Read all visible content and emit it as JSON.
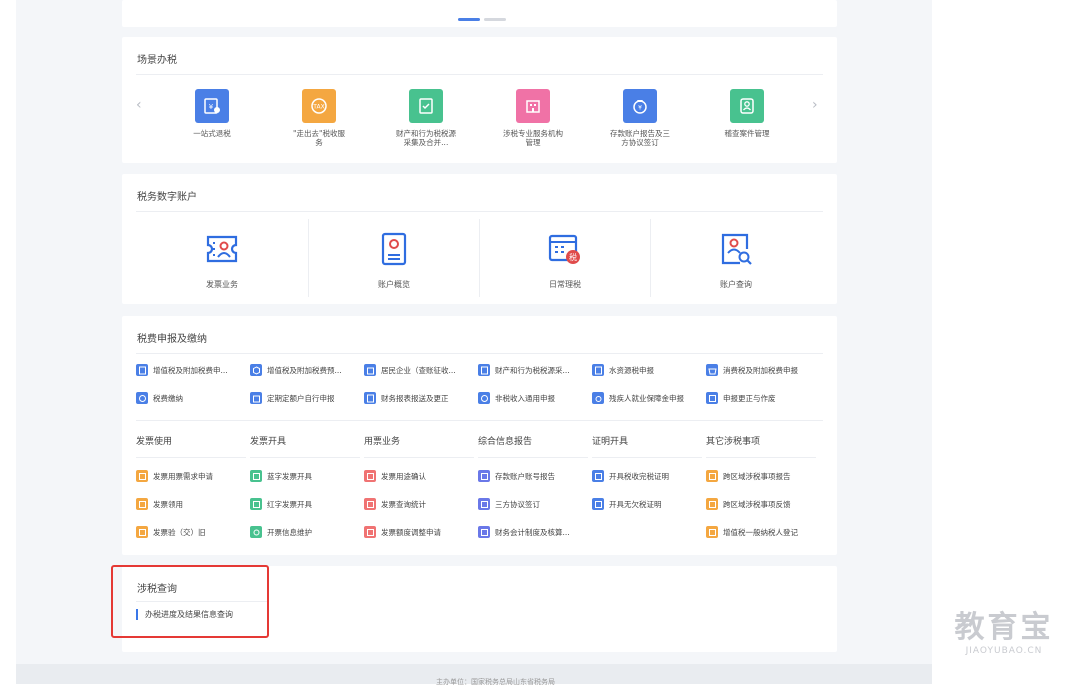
{
  "colors": {
    "blue": "#4a7fe6",
    "orange": "#f4a741",
    "green": "#48c28f",
    "pink": "#f072a6",
    "purple": "#6a78e8",
    "red": "#e53935"
  },
  "scene": {
    "title": "场景办税",
    "items": [
      {
        "label": "一站式退税",
        "icon": "refund-icon",
        "color": "#4a7fe6"
      },
      {
        "label": "\"走出去\"税收服务",
        "icon": "tax-globe-icon",
        "color": "#f4a741"
      },
      {
        "label": "财产和行为税税源采集及合并...",
        "icon": "document-check-icon",
        "color": "#48c28f"
      },
      {
        "label": "涉税专业服务机构管理",
        "icon": "building-icon",
        "color": "#f072a6"
      },
      {
        "label": "存款账户报告及三方协议签订",
        "icon": "money-bag-icon",
        "color": "#4a7fe6"
      },
      {
        "label": "稽查案件管理",
        "icon": "person-badge-icon",
        "color": "#48c28f"
      }
    ]
  },
  "digital": {
    "title": "税务数字账户",
    "items": [
      {
        "label": "发票业务",
        "icon": "invoice-person-icon"
      },
      {
        "label": "账户概览",
        "icon": "account-book-icon"
      },
      {
        "label": "日常理税",
        "icon": "calendar-tax-icon"
      },
      {
        "label": "账户查询",
        "icon": "person-search-icon"
      }
    ]
  },
  "declare": {
    "title": "税费申报及缴纳",
    "rows": [
      [
        {
          "label": "增值税及附加税费申...",
          "color": "#4a7fe6"
        },
        {
          "label": "增值税及附加税费预...",
          "color": "#4a7fe6"
        },
        {
          "label": "居民企业（查账征收...",
          "color": "#4a7fe6"
        },
        {
          "label": "财产和行为税税源采...",
          "color": "#4a7fe6"
        },
        {
          "label": "水资源税申报",
          "color": "#4a7fe6"
        },
        {
          "label": "消费税及附加税费申报",
          "color": "#4a7fe6"
        }
      ],
      [
        {
          "label": "税费缴纳",
          "color": "#4a7fe6"
        },
        {
          "label": "定期定额户自行申报",
          "color": "#4a7fe6"
        },
        {
          "label": "财务报表报送及更正",
          "color": "#4a7fe6"
        },
        {
          "label": "非税收入通用申报",
          "color": "#4a7fe6"
        },
        {
          "label": "残疾人就业保障金申报",
          "color": "#4a7fe6"
        },
        {
          "label": "申报更正与作废",
          "color": "#4a7fe6"
        }
      ]
    ],
    "categories": [
      {
        "head": "发票使用",
        "items": [
          {
            "label": "发票用票需求申请",
            "color": "#f4a741"
          },
          {
            "label": "发票领用",
            "color": "#f4a741"
          },
          {
            "label": "发票验（交）旧",
            "color": "#f4a741"
          }
        ]
      },
      {
        "head": "发票开具",
        "items": [
          {
            "label": "蓝字发票开具",
            "color": "#48c28f"
          },
          {
            "label": "红字发票开具",
            "color": "#48c28f"
          },
          {
            "label": "开票信息维护",
            "color": "#48c28f"
          }
        ]
      },
      {
        "head": "用票业务",
        "items": [
          {
            "label": "发票用途确认",
            "color": "#f07373"
          },
          {
            "label": "发票查询统计",
            "color": "#f07373"
          },
          {
            "label": "发票额度调整申请",
            "color": "#f07373"
          }
        ]
      },
      {
        "head": "综合信息报告",
        "items": [
          {
            "label": "存款账户账号报告",
            "color": "#6a78e8"
          },
          {
            "label": "三方协议签订",
            "color": "#6a78e8"
          },
          {
            "label": "财务会计制度及核算...",
            "color": "#6a78e8"
          }
        ]
      },
      {
        "head": "证明开具",
        "items": [
          {
            "label": "开具税收完税证明",
            "color": "#4a7fe6"
          },
          {
            "label": "开具无欠税证明",
            "color": "#4a7fe6"
          }
        ]
      },
      {
        "head": "其它涉税事项",
        "items": [
          {
            "label": "跨区域涉税事项报告",
            "color": "#f4a741"
          },
          {
            "label": "跨区域涉税事项反馈",
            "color": "#f4a741"
          },
          {
            "label": "增值税一般纳税人登记",
            "color": "#f4a741"
          }
        ]
      }
    ]
  },
  "query": {
    "title": "涉税查询",
    "item": "办税进度及结果信息查询"
  },
  "footer": {
    "text": "主办单位：国家税务总局山东省税务局"
  },
  "watermark": {
    "main": "教育宝",
    "sub": "JIAOYUBAO.CN"
  }
}
